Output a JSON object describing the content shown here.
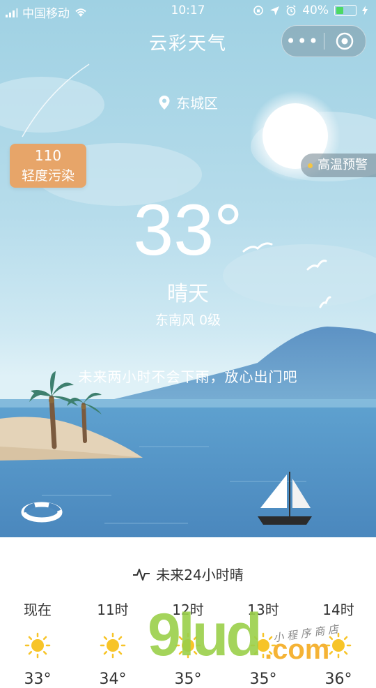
{
  "status_bar": {
    "carrier": "中国移动",
    "time": "10:17",
    "battery": "40%",
    "battery_level": 0.4
  },
  "nav": {
    "title": "云彩天气",
    "more_label": "•••"
  },
  "location": {
    "icon": "location-pin-icon",
    "name": "东城区"
  },
  "aqi": {
    "value": "110",
    "label": "轻度污染",
    "color": "#e7a569"
  },
  "alert": {
    "label": "高温预警",
    "dot_color": "#f5c542"
  },
  "current": {
    "temperature": "33°",
    "condition": "晴天",
    "wind": "东南风 0级",
    "tip": "未来两小时不会下雨，放心出门吧"
  },
  "forecast": {
    "icon": "pulse-icon",
    "title": "未来24小时晴",
    "hours": [
      {
        "time": "现在",
        "icon": "sun-icon",
        "temp": "33°"
      },
      {
        "time": "11时",
        "icon": "sun-icon",
        "temp": "34°"
      },
      {
        "time": "12时",
        "icon": "sun-icon",
        "temp": "35°"
      },
      {
        "time": "13时",
        "icon": "sun-icon",
        "temp": "35°"
      },
      {
        "time": "14时",
        "icon": "sun-icon",
        "temp": "36°"
      }
    ]
  },
  "watermark": {
    "brand": "9lud",
    "domain": ".com",
    "tagline": "小 程 序 商 店"
  },
  "colors": {
    "sky_top": "#9fd1e3",
    "sea": "#4f93c6",
    "sun_icon": "#f7c428"
  }
}
